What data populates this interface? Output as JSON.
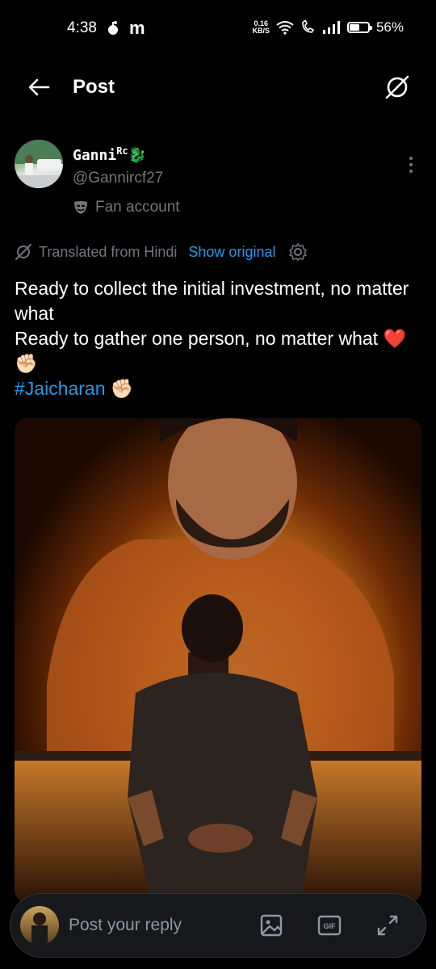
{
  "status_bar": {
    "time": "4:38",
    "app_letter": "m",
    "speed": "0.16",
    "speed_unit": "KB/S",
    "battery": "56%",
    "battery_level": 0.56
  },
  "app_bar": {
    "title": "Post"
  },
  "post": {
    "author_name": "Ganni",
    "author_superscript": "Rc",
    "author_emoji": "🐉",
    "handle": "@Gannircf27",
    "label": "Fan account",
    "translated_from": "Translated from Hindi",
    "show_original": "Show original",
    "line1": "Ready to collect the initial investment, no matter what",
    "line2": "Ready to gather one person, no matter what ❤️✊🏻",
    "hashtag": "#Jaicharan",
    "hashtag_emoji": " ✊🏻"
  },
  "reply_bar": {
    "placeholder": "Post your reply"
  },
  "colors": {
    "accent": "#1d9bf0",
    "secondary_text": "#71767b",
    "background": "#000000"
  }
}
